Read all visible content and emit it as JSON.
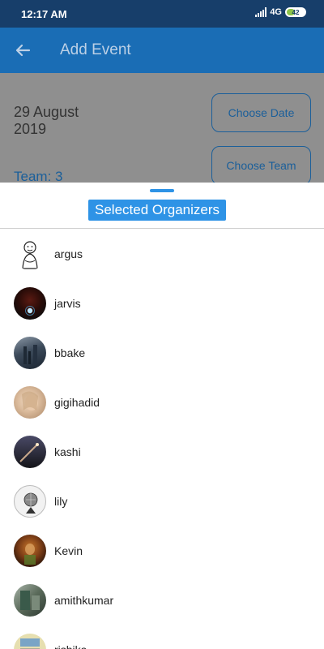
{
  "status_bar": {
    "time": "12:17 AM",
    "network": "4G",
    "battery": "42"
  },
  "app_bar": {
    "title": "Add Event",
    "back_icon": "arrow-back-icon"
  },
  "form": {
    "date": "29 August 2019",
    "choose_date_label": "Choose Date",
    "choose_team_label": "Choose Team",
    "team_label": "Team: 3"
  },
  "sheet": {
    "title": "Selected Organizers",
    "organizers": [
      {
        "name": "argus",
        "avatar_color": "#ffffff"
      },
      {
        "name": "jarvis",
        "avatar_color": "#1a1a1a"
      },
      {
        "name": "bbake",
        "avatar_color": "#3c4a5a"
      },
      {
        "name": "gigihadid",
        "avatar_color": "#d9b99a"
      },
      {
        "name": "kashi",
        "avatar_color": "#2a2a38"
      },
      {
        "name": "lily",
        "avatar_color": "#e8e8e8"
      },
      {
        "name": "Kevin",
        "avatar_color": "#4a2a18"
      },
      {
        "name": "amithkumar",
        "avatar_color": "#5a6a5a"
      },
      {
        "name": "rishika",
        "avatar_color": "#c9c38a"
      }
    ]
  },
  "colors": {
    "status_bar": "#173e6a",
    "app_bar": "#1a6db5",
    "accent": "#2e93e6"
  }
}
